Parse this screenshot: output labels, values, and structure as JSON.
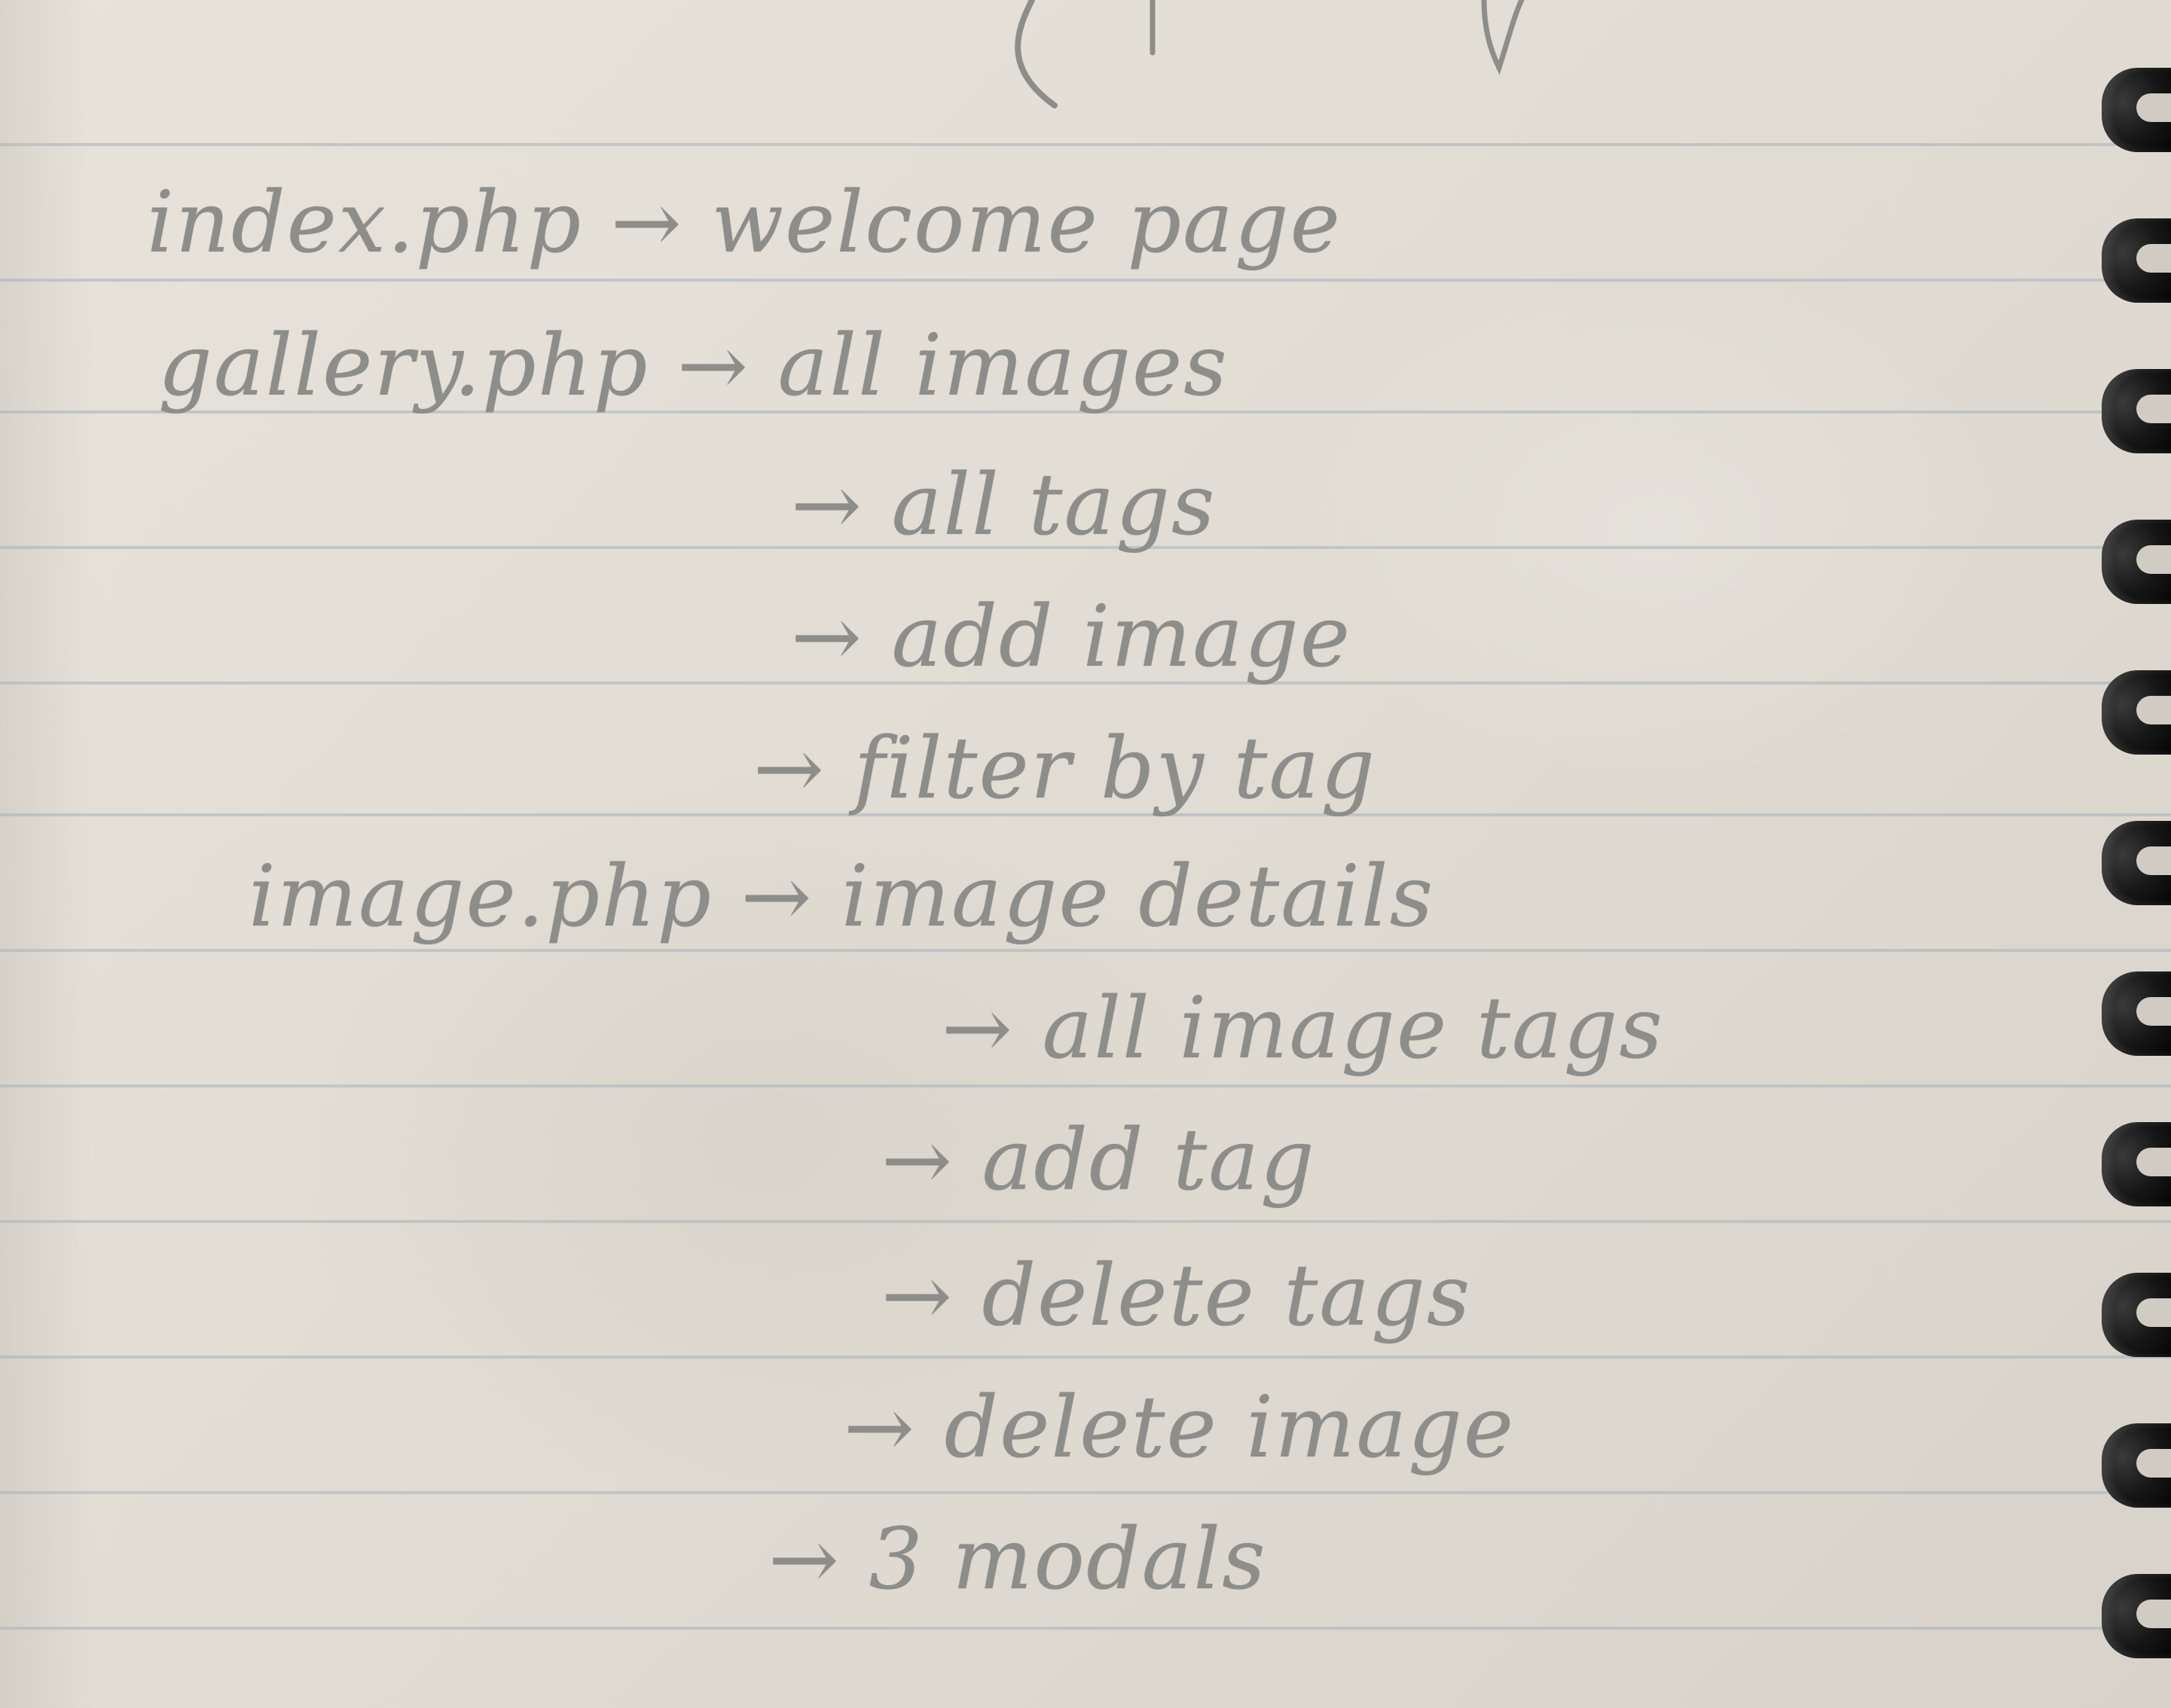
{
  "notes": {
    "lines": [
      "index.php → welcome page",
      "gallery.php → all images",
      "→ all tags",
      "→ add image",
      "→ filter by tag",
      "image.php → image details",
      "→ all image tags",
      "→ add tag",
      "→ delete tags",
      "→ delete image",
      "→ 3 modals"
    ]
  }
}
